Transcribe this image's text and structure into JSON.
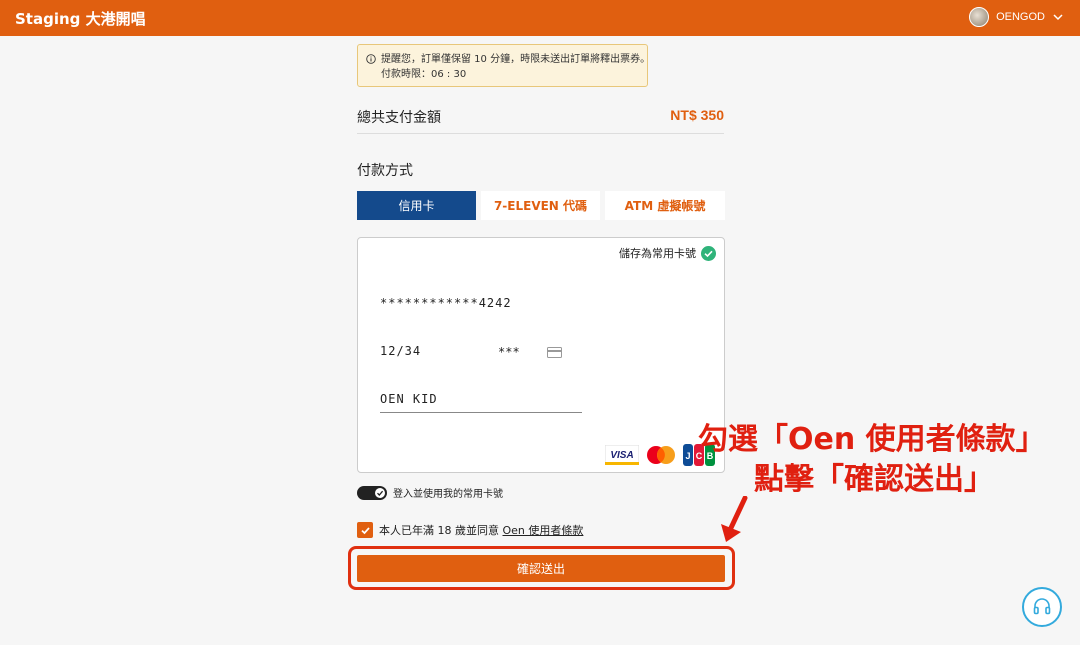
{
  "header": {
    "brand": "Staging 大港開唱",
    "username": "OENGOD"
  },
  "notice": {
    "line1": "提醒您，訂單僅保留 10 分鐘，時限未送出訂單將釋出票券。",
    "line2_label": "付款時限：",
    "line2_time": "06 : 30"
  },
  "order": {
    "total_label": "總共支付金額",
    "total_amount": "NT$ 350"
  },
  "payment": {
    "title": "付款方式",
    "tabs": [
      {
        "label": "信用卡",
        "active": true
      },
      {
        "label": "7-ELEVEN 代碼",
        "active": false
      },
      {
        "label": "ATM 虛擬帳號",
        "active": false
      }
    ],
    "save_card_label": "儲存為常用卡號",
    "card_number": "************4242",
    "expiry": "12/34",
    "cvv": "***",
    "holder_name": "OEN KID",
    "card_brands": [
      "VISA",
      "Mastercard",
      "JCB"
    ]
  },
  "toggle": {
    "label": "登入並使用我的常用卡號",
    "on": true
  },
  "agreement": {
    "prefix": "本人已年滿 18 歲並同意 ",
    "link": "Oen 使用者條款",
    "checked": true
  },
  "submit_label": "確認送出",
  "annotation": {
    "line1": "勾選「Oen 使用者條款」",
    "line2": "點擊「確認送出」"
  },
  "colors": {
    "brand": "#e05f10",
    "active_tab": "#144a8c",
    "annotation": "#e02010",
    "notice_bg": "#fcf3dc"
  }
}
